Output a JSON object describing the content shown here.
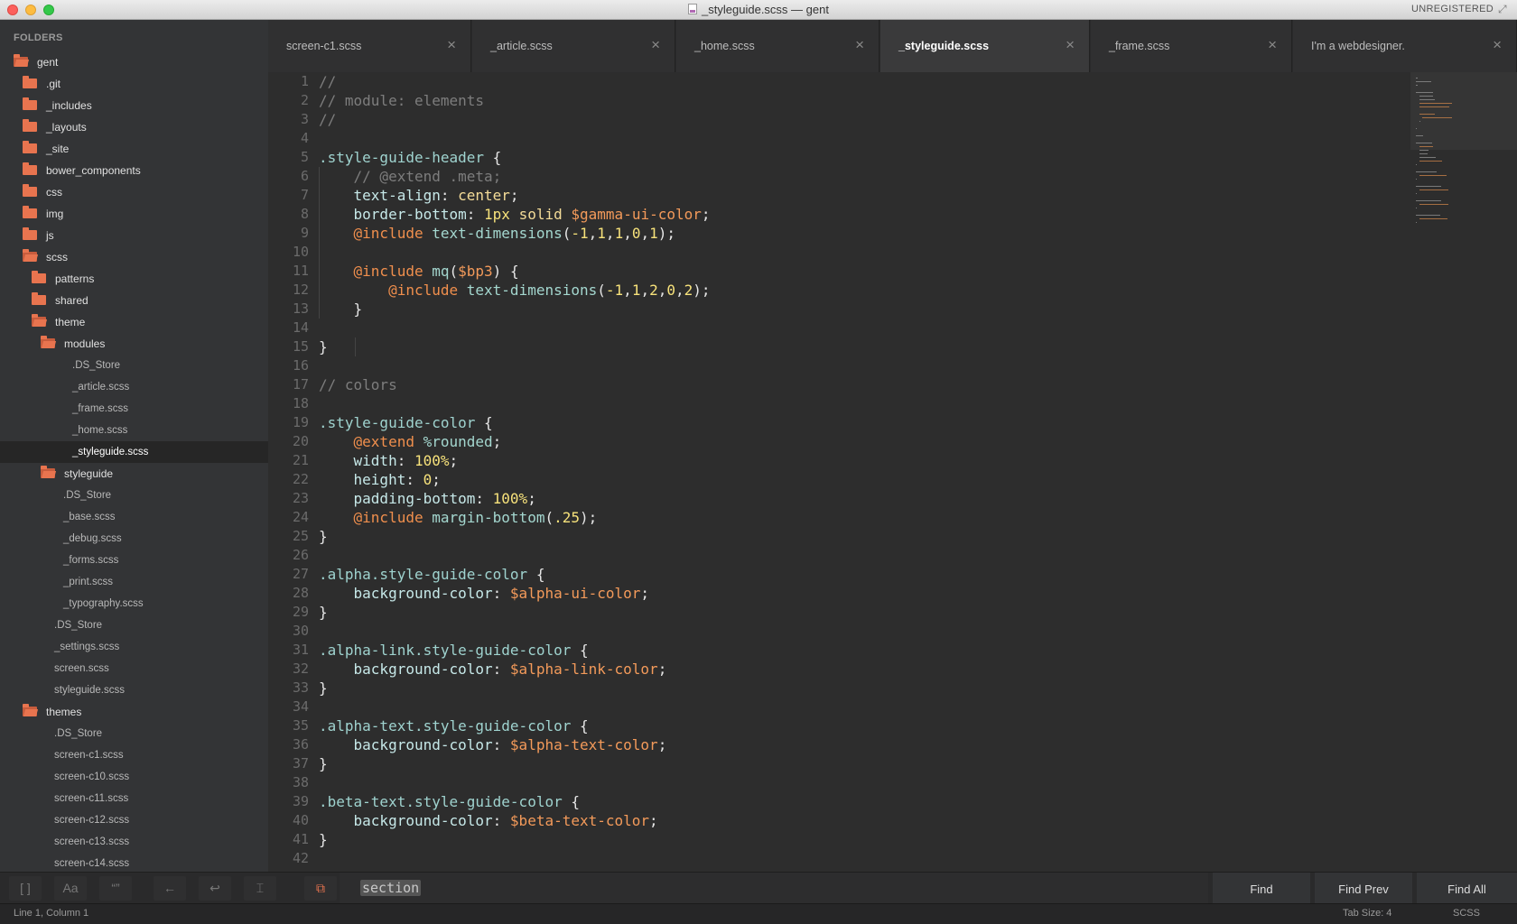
{
  "window": {
    "title": "_styleguide.scss — gent",
    "registration": "UNREGISTERED"
  },
  "sidebar": {
    "header": "FOLDERS",
    "items": [
      {
        "label": "gent",
        "kind": "folder-open",
        "depth": 0
      },
      {
        "label": ".git",
        "kind": "folder",
        "depth": 1
      },
      {
        "label": "_includes",
        "kind": "folder",
        "depth": 1
      },
      {
        "label": "_layouts",
        "kind": "folder",
        "depth": 1
      },
      {
        "label": "_site",
        "kind": "folder",
        "depth": 1
      },
      {
        "label": "bower_components",
        "kind": "folder",
        "depth": 1
      },
      {
        "label": "css",
        "kind": "folder",
        "depth": 1
      },
      {
        "label": "img",
        "kind": "folder",
        "depth": 1
      },
      {
        "label": "js",
        "kind": "folder",
        "depth": 1
      },
      {
        "label": "scss",
        "kind": "folder-open",
        "depth": 1
      },
      {
        "label": "patterns",
        "kind": "folder",
        "depth": 2
      },
      {
        "label": "shared",
        "kind": "folder",
        "depth": 2
      },
      {
        "label": "theme",
        "kind": "folder-open",
        "depth": 2
      },
      {
        "label": "modules",
        "kind": "folder-open",
        "depth": 3
      },
      {
        "label": ".DS_Store",
        "kind": "file",
        "depth": 4
      },
      {
        "label": "_article.scss",
        "kind": "file",
        "depth": 4
      },
      {
        "label": "_frame.scss",
        "kind": "file",
        "depth": 4
      },
      {
        "label": "_home.scss",
        "kind": "file",
        "depth": 4
      },
      {
        "label": "_styleguide.scss",
        "kind": "file",
        "depth": 4,
        "selected": true
      },
      {
        "label": "styleguide",
        "kind": "folder-open",
        "depth": 3
      },
      {
        "label": ".DS_Store",
        "kind": "file",
        "depth": 3.6
      },
      {
        "label": "_base.scss",
        "kind": "file",
        "depth": 3.6
      },
      {
        "label": "_debug.scss",
        "kind": "file",
        "depth": 3.6
      },
      {
        "label": "_forms.scss",
        "kind": "file",
        "depth": 3.6
      },
      {
        "label": "_print.scss",
        "kind": "file",
        "depth": 3.6
      },
      {
        "label": "_typography.scss",
        "kind": "file",
        "depth": 3.6
      },
      {
        "label": ".DS_Store",
        "kind": "file",
        "depth": 3.2
      },
      {
        "label": "_settings.scss",
        "kind": "file",
        "depth": 3.2
      },
      {
        "label": "screen.scss",
        "kind": "file",
        "depth": 3.2
      },
      {
        "label": "styleguide.scss",
        "kind": "file",
        "depth": 3.2
      },
      {
        "label": "themes",
        "kind": "folder-open",
        "depth": 1
      },
      {
        "label": ".DS_Store",
        "kind": "file",
        "depth": 3.2
      },
      {
        "label": "screen-c1.scss",
        "kind": "file",
        "depth": 3.2
      },
      {
        "label": "screen-c10.scss",
        "kind": "file",
        "depth": 3.2
      },
      {
        "label": "screen-c11.scss",
        "kind": "file",
        "depth": 3.2
      },
      {
        "label": "screen-c12.scss",
        "kind": "file",
        "depth": 3.2
      },
      {
        "label": "screen-c13.scss",
        "kind": "file",
        "depth": 3.2
      },
      {
        "label": "screen-c14.scss",
        "kind": "file",
        "depth": 3.2
      }
    ]
  },
  "tabs": [
    {
      "label": "screen-c1.scss",
      "active": false
    },
    {
      "label": "_article.scss",
      "active": false
    },
    {
      "label": "_home.scss",
      "active": false
    },
    {
      "label": "_styleguide.scss",
      "active": true
    },
    {
      "label": "_frame.scss",
      "active": false
    },
    {
      "label": "I'm a webdesigner.",
      "active": false
    }
  ],
  "editor": {
    "line_numbers": [
      "1",
      "2",
      "3",
      "4",
      "5",
      "6",
      "7",
      "8",
      "9",
      "10",
      "11",
      "12",
      "13",
      "14",
      "15",
      "16",
      "17",
      "18",
      "19",
      "20",
      "21",
      "22",
      "23",
      "24",
      "25",
      "26",
      "27",
      "28",
      "29",
      "30",
      "31",
      "32",
      "33",
      "34",
      "35",
      "36",
      "37",
      "38",
      "39",
      "40",
      "41",
      "42"
    ],
    "lines": [
      [
        [
          "cm",
          "//"
        ]
      ],
      [
        [
          "cm",
          "// module: elements"
        ]
      ],
      [
        [
          "cm",
          "//"
        ]
      ],
      [],
      [
        [
          "sel",
          ".style-guide-header"
        ],
        [
          "pun",
          " {"
        ]
      ],
      [
        [
          "pun",
          "    "
        ],
        [
          "cm",
          "// @extend .meta;"
        ]
      ],
      [
        [
          "pun",
          "    "
        ],
        [
          "prop",
          "text-align"
        ],
        [
          "pun",
          ": "
        ],
        [
          "val",
          "center"
        ],
        [
          "pun",
          ";"
        ]
      ],
      [
        [
          "pun",
          "    "
        ],
        [
          "prop",
          "border-bottom"
        ],
        [
          "pun",
          ": "
        ],
        [
          "num",
          "1px"
        ],
        [
          "pun",
          " "
        ],
        [
          "val",
          "solid"
        ],
        [
          "pun",
          " "
        ],
        [
          "var",
          "$gamma-ui-color"
        ],
        [
          "pun",
          ";"
        ]
      ],
      [
        [
          "pun",
          "    "
        ],
        [
          "at",
          "@include"
        ],
        [
          "pun",
          " "
        ],
        [
          "fn",
          "text-dimensions"
        ],
        [
          "pun",
          "("
        ],
        [
          "num",
          "-1"
        ],
        [
          "pun",
          ","
        ],
        [
          "num",
          "1"
        ],
        [
          "pun",
          ","
        ],
        [
          "num",
          "1"
        ],
        [
          "pun",
          ","
        ],
        [
          "num",
          "0"
        ],
        [
          "pun",
          ","
        ],
        [
          "num",
          "1"
        ],
        [
          "pun",
          ");"
        ]
      ],
      [],
      [
        [
          "pun",
          "    "
        ],
        [
          "at",
          "@include"
        ],
        [
          "pun",
          " "
        ],
        [
          "fn",
          "mq"
        ],
        [
          "pun",
          "("
        ],
        [
          "var",
          "$bp3"
        ],
        [
          "pun",
          ") {"
        ]
      ],
      [
        [
          "pun",
          "        "
        ],
        [
          "at",
          "@include"
        ],
        [
          "pun",
          " "
        ],
        [
          "fn",
          "text-dimensions"
        ],
        [
          "pun",
          "("
        ],
        [
          "num",
          "-1"
        ],
        [
          "pun",
          ","
        ],
        [
          "num",
          "1"
        ],
        [
          "pun",
          ","
        ],
        [
          "num",
          "2"
        ],
        [
          "pun",
          ","
        ],
        [
          "num",
          "0"
        ],
        [
          "pun",
          ","
        ],
        [
          "num",
          "2"
        ],
        [
          "pun",
          ");"
        ]
      ],
      [
        [
          "pun",
          "    }"
        ]
      ],
      [],
      [
        [
          "pun",
          "}"
        ]
      ],
      [],
      [
        [
          "cm",
          "// colors"
        ]
      ],
      [],
      [
        [
          "sel",
          ".style-guide-color"
        ],
        [
          "pun",
          " {"
        ]
      ],
      [
        [
          "pun",
          "    "
        ],
        [
          "at",
          "@extend"
        ],
        [
          "pun",
          " "
        ],
        [
          "fn",
          "%rounded"
        ],
        [
          "pun",
          ";"
        ]
      ],
      [
        [
          "pun",
          "    "
        ],
        [
          "prop",
          "width"
        ],
        [
          "pun",
          ": "
        ],
        [
          "num",
          "100%"
        ],
        [
          "pun",
          ";"
        ]
      ],
      [
        [
          "pun",
          "    "
        ],
        [
          "prop",
          "height"
        ],
        [
          "pun",
          ": "
        ],
        [
          "num",
          "0"
        ],
        [
          "pun",
          ";"
        ]
      ],
      [
        [
          "pun",
          "    "
        ],
        [
          "prop",
          "padding-bottom"
        ],
        [
          "pun",
          ": "
        ],
        [
          "num",
          "100%"
        ],
        [
          "pun",
          ";"
        ]
      ],
      [
        [
          "pun",
          "    "
        ],
        [
          "at",
          "@include"
        ],
        [
          "pun",
          " "
        ],
        [
          "fn",
          "margin-bottom"
        ],
        [
          "pun",
          "("
        ],
        [
          "num",
          ".25"
        ],
        [
          "pun",
          ");"
        ]
      ],
      [
        [
          "pun",
          "}"
        ]
      ],
      [],
      [
        [
          "sel",
          ".alpha.style-guide-color"
        ],
        [
          "pun",
          " {"
        ]
      ],
      [
        [
          "pun",
          "    "
        ],
        [
          "prop",
          "background-color"
        ],
        [
          "pun",
          ": "
        ],
        [
          "var",
          "$alpha-ui-color"
        ],
        [
          "pun",
          ";"
        ]
      ],
      [
        [
          "pun",
          "}"
        ]
      ],
      [],
      [
        [
          "sel",
          ".alpha-link.style-guide-color"
        ],
        [
          "pun",
          " {"
        ]
      ],
      [
        [
          "pun",
          "    "
        ],
        [
          "prop",
          "background-color"
        ],
        [
          "pun",
          ": "
        ],
        [
          "var",
          "$alpha-link-color"
        ],
        [
          "pun",
          ";"
        ]
      ],
      [
        [
          "pun",
          "}"
        ]
      ],
      [],
      [
        [
          "sel",
          ".alpha-text.style-guide-color"
        ],
        [
          "pun",
          " {"
        ]
      ],
      [
        [
          "pun",
          "    "
        ],
        [
          "prop",
          "background-color"
        ],
        [
          "pun",
          ": "
        ],
        [
          "var",
          "$alpha-text-color"
        ],
        [
          "pun",
          ";"
        ]
      ],
      [
        [
          "pun",
          "}"
        ]
      ],
      [],
      [
        [
          "sel",
          ".beta-text.style-guide-color"
        ],
        [
          "pun",
          " {"
        ]
      ],
      [
        [
          "pun",
          "    "
        ],
        [
          "prop",
          "background-color"
        ],
        [
          "pun",
          ": "
        ],
        [
          "var",
          "$beta-text-color"
        ],
        [
          "pun",
          ";"
        ]
      ],
      [
        [
          "pun",
          "}"
        ]
      ],
      []
    ]
  },
  "find_panel": {
    "toggles": [
      "regex-icon",
      "case-sensitive-icon",
      "whole-word-icon",
      "reverse-icon",
      "wrap-icon",
      "in-selection-icon",
      "highlight-matches-icon"
    ],
    "search_term": "section",
    "find_label": "Find",
    "find_prev_label": "Find Prev",
    "find_all_label": "Find All"
  },
  "status": {
    "position": "Line 1, Column 1",
    "tab_size": "Tab Size: 4",
    "syntax": "SCSS"
  },
  "colors": {
    "accent": "#e8744f",
    "folder": "#e8744f"
  }
}
